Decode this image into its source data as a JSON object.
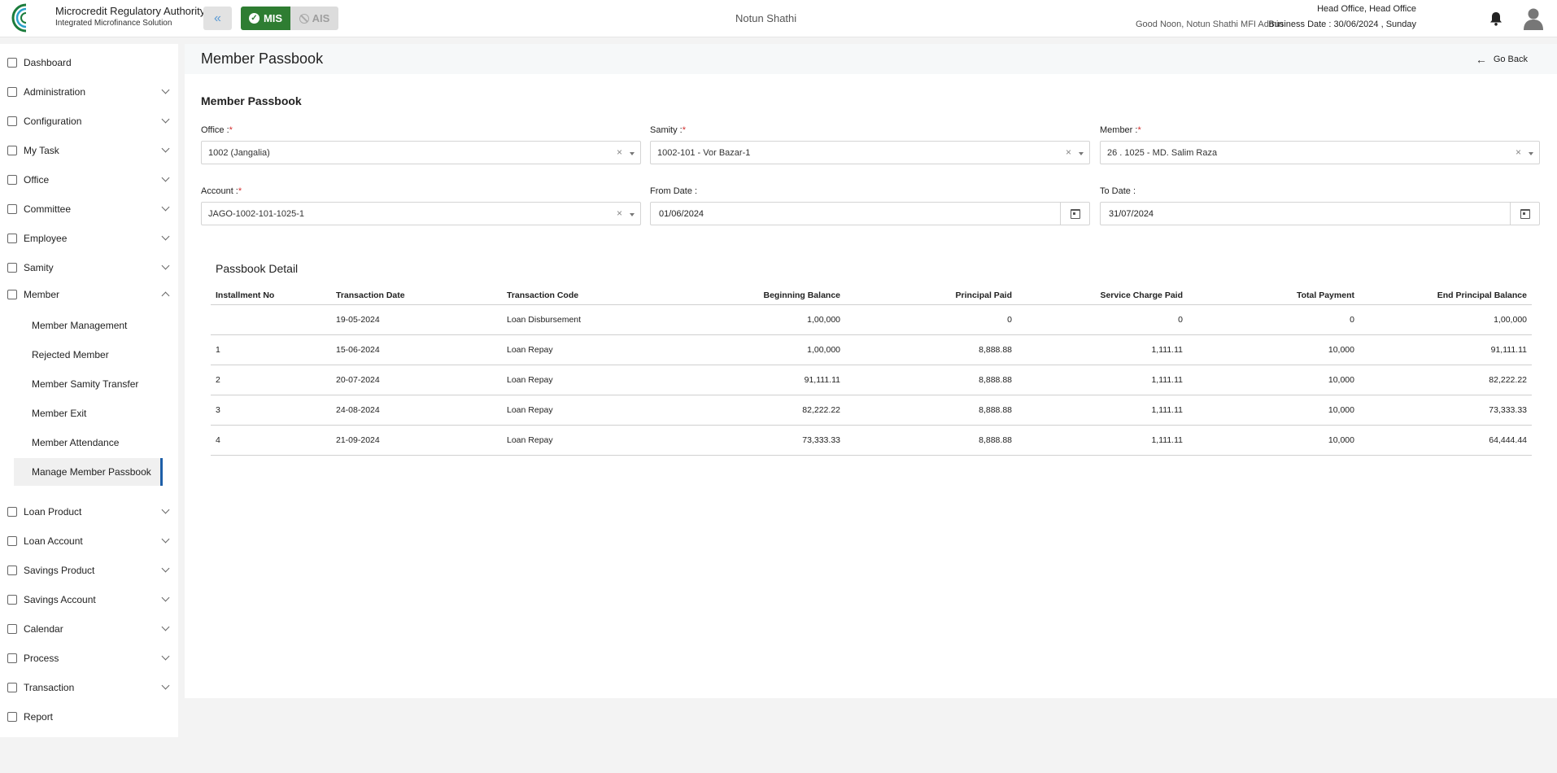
{
  "header": {
    "logo_text": "Microcredit Regulatory Authority",
    "brand_title": "Microcredit Regulatory Authority",
    "brand_subtitle": "Integrated Microfinance Solution",
    "mis_label": "MIS",
    "ais_label": "AIS",
    "center_name": "Notun Shathi",
    "greeting": "Good Noon, Notun Shathi MFI Admin",
    "office": "Head Office, Head Office",
    "business_date": "Business Date : 30/06/2024 , Sunday",
    "colors": {
      "mis_active": "#2e7d32",
      "ais_disabled": "#dcdcdc"
    }
  },
  "sidebar": {
    "items": [
      {
        "label": "Dashboard",
        "icon": "dashboard-icon",
        "has_chevron": false
      },
      {
        "label": "Administration",
        "icon": "admin-icon",
        "has_chevron": true
      },
      {
        "label": "Configuration",
        "icon": "config-icon",
        "has_chevron": true
      },
      {
        "label": "My Task",
        "icon": "task-icon",
        "has_chevron": true
      },
      {
        "label": "Office",
        "icon": "office-icon",
        "has_chevron": true
      },
      {
        "label": "Committee",
        "icon": "committee-icon",
        "has_chevron": true
      },
      {
        "label": "Employee",
        "icon": "employee-icon",
        "has_chevron": true
      },
      {
        "label": "Samity",
        "icon": "samity-icon",
        "has_chevron": true
      },
      {
        "label": "Member",
        "icon": "member-icon",
        "has_chevron": true,
        "expanded": true
      }
    ],
    "member_submenu": [
      {
        "label": "Member Management"
      },
      {
        "label": "Rejected Member"
      },
      {
        "label": "Member Samity Transfer"
      },
      {
        "label": "Member Exit"
      },
      {
        "label": "Member Attendance"
      },
      {
        "label": "Manage Member Passbook",
        "active": true
      }
    ],
    "items_after": [
      {
        "label": "Loan Product",
        "icon": "loan-product-icon",
        "has_chevron": true
      },
      {
        "label": "Loan Account",
        "icon": "loan-account-icon",
        "has_chevron": true
      },
      {
        "label": "Savings Product",
        "icon": "savings-product-icon",
        "has_chevron": true
      },
      {
        "label": "Savings Account",
        "icon": "savings-account-icon",
        "has_chevron": true
      },
      {
        "label": "Calendar",
        "icon": "calendar-icon",
        "has_chevron": true
      },
      {
        "label": "Process",
        "icon": "process-icon",
        "has_chevron": true
      },
      {
        "label": "Transaction",
        "icon": "transaction-icon",
        "has_chevron": true
      },
      {
        "label": "Report",
        "icon": "report-icon",
        "has_chevron": false
      }
    ],
    "active_color": "#1e5fa8"
  },
  "main": {
    "page_title": "Member Passbook",
    "go_back": "Go Back",
    "section_title": "Member Passbook",
    "fields": {
      "office": {
        "label": "Office :",
        "required": "*",
        "value": "1002 (Jangalia)"
      },
      "samity": {
        "label": "Samity :",
        "required": "*",
        "value": "1002-101 - Vor Bazar-1"
      },
      "member": {
        "label": "Member :",
        "required": "*",
        "value": "26 . 1025 - MD. Salim Raza"
      },
      "account": {
        "label": "Account :",
        "required": "*",
        "value": "JAGO-1002-101-1025-1"
      },
      "from_date": {
        "label": "From Date :",
        "value": "01/06/2024"
      },
      "to_date": {
        "label": "To Date :",
        "value": "31/07/2024"
      }
    },
    "clear_glyph": "×",
    "passbook": {
      "title": "Passbook Detail",
      "columns": [
        "Installment No",
        "Transaction Date",
        "Transaction Code",
        "Beginning Balance",
        "Principal Paid",
        "Service Charge Paid",
        "Total Payment",
        "End Principal Balance"
      ],
      "rows": [
        [
          "",
          "19-05-2024",
          "Loan Disbursement",
          "1,00,000",
          "0",
          "0",
          "0",
          "1,00,000"
        ],
        [
          "1",
          "15-06-2024",
          "Loan Repay",
          "1,00,000",
          "8,888.88",
          "1,111.11",
          "10,000",
          "91,111.11"
        ],
        [
          "2",
          "20-07-2024",
          "Loan Repay",
          "91,111.11",
          "8,888.88",
          "1,111.11",
          "10,000",
          "82,222.22"
        ],
        [
          "3",
          "24-08-2024",
          "Loan Repay",
          "82,222.22",
          "8,888.88",
          "1,111.11",
          "10,000",
          "73,333.33"
        ],
        [
          "4",
          "21-09-2024",
          "Loan Repay",
          "73,333.33",
          "8,888.88",
          "1,111.11",
          "10,000",
          "64,444.44"
        ]
      ]
    }
  }
}
